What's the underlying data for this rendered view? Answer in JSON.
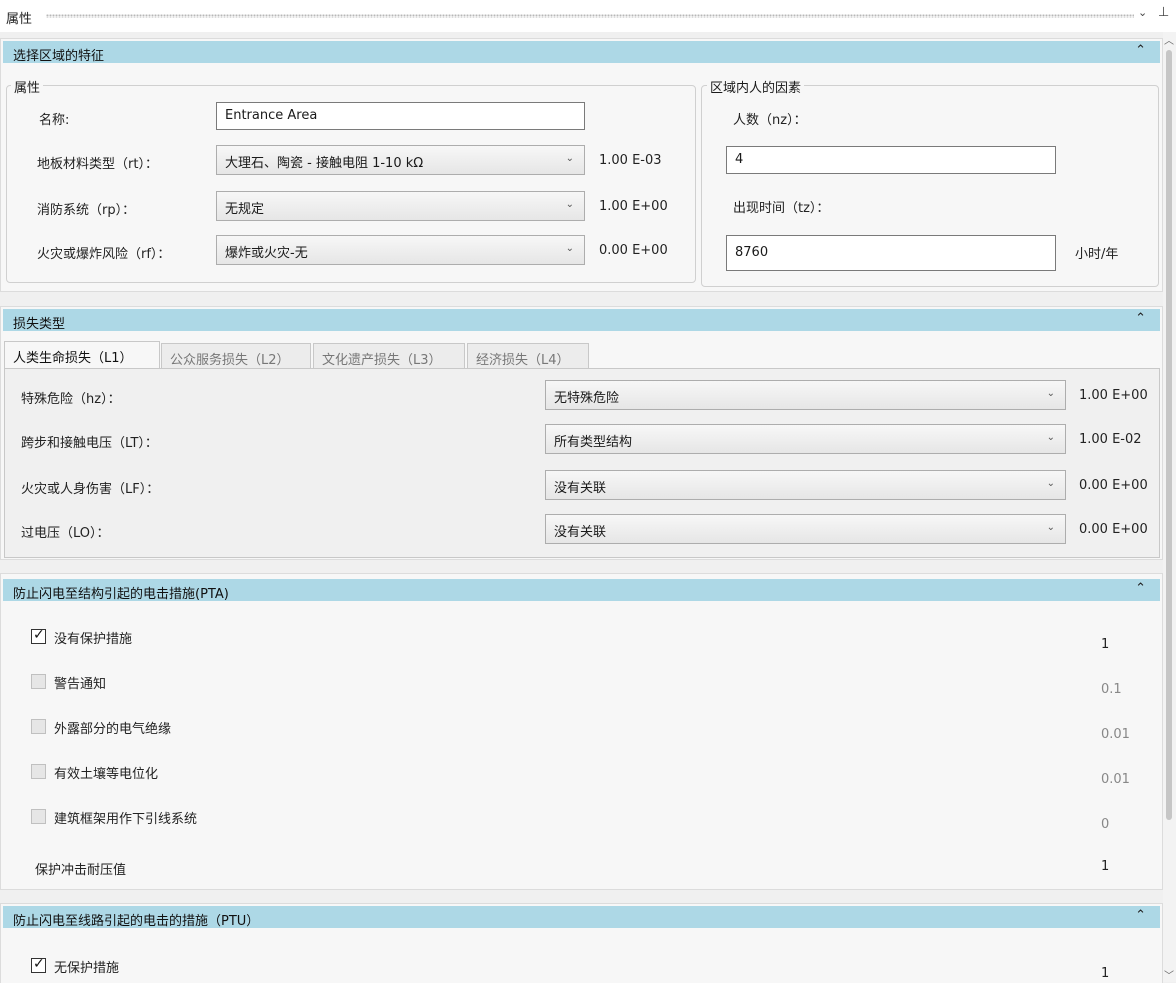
{
  "window": {
    "title": "属性"
  },
  "section1": {
    "title": "选择区域的特征",
    "props_group": "属性",
    "name_label": "名称:",
    "name_value": "Entrance Area",
    "floor_label": "地板材料类型（rt）：",
    "floor_value": "大理石、陶瓷 - 接触电阻 1-10 kΩ",
    "floor_factor": "1.00 E-03",
    "fire_label": "消防系统（rp）：",
    "fire_value": "无规定",
    "fire_factor": "1.00 E+00",
    "risk_label": "火灾或爆炸风险（rf）：",
    "risk_value": "爆炸或火灾-无",
    "risk_factor": "0.00 E+00",
    "people_group": "区域内人的因素",
    "nz_label": "人数（nz）：",
    "nz_value": "4",
    "tz_label": "出现时间（tz）：",
    "tz_value": "8760",
    "tz_unit": "小时/年"
  },
  "section2": {
    "title": "损失类型",
    "tabs": [
      "人类生命损失（L1）",
      "公众服务损失（L2）",
      "文化遗产损失（L3）",
      "经济损失（L4）"
    ],
    "rows": [
      {
        "label": "特殊危险（hz）：",
        "value": "无特殊危险",
        "factor": "1.00 E+00"
      },
      {
        "label": "跨步和接触电压（LT）：",
        "value": "所有类型结构",
        "factor": "1.00 E-02"
      },
      {
        "label": "火灾或人身伤害（LF）：",
        "value": "没有关联",
        "factor": "0.00 E+00"
      },
      {
        "label": "过电压（LO）：",
        "value": "没有关联",
        "factor": "0.00 E+00"
      }
    ]
  },
  "section3": {
    "title": "防止闪电至结构引起的电击措施(PTA)",
    "items": [
      {
        "label": "没有保护措施",
        "checked": true,
        "value": "1"
      },
      {
        "label": "警告通知",
        "checked": false,
        "value": "0.1"
      },
      {
        "label": "外露部分的电气绝缘",
        "checked": false,
        "value": "0.01"
      },
      {
        "label": "有效土壤等电位化",
        "checked": false,
        "value": "0.01"
      },
      {
        "label": "建筑框架用作下引线系统",
        "checked": false,
        "value": "0"
      }
    ],
    "withstand_label": "保护冲击耐压值",
    "withstand_value": "1"
  },
  "section4": {
    "title": "防止闪电至线路引起的电击的措施（PTU）",
    "items": [
      {
        "label": "无保护措施",
        "checked": true,
        "value": "1"
      }
    ]
  },
  "colors": {
    "section_header": "#add8e6",
    "panel": "#f7f7f7"
  },
  "icons": {
    "collapse": "chevron-up-icon",
    "dropdown": "chevron-down-icon",
    "pin": "pin-icon"
  }
}
